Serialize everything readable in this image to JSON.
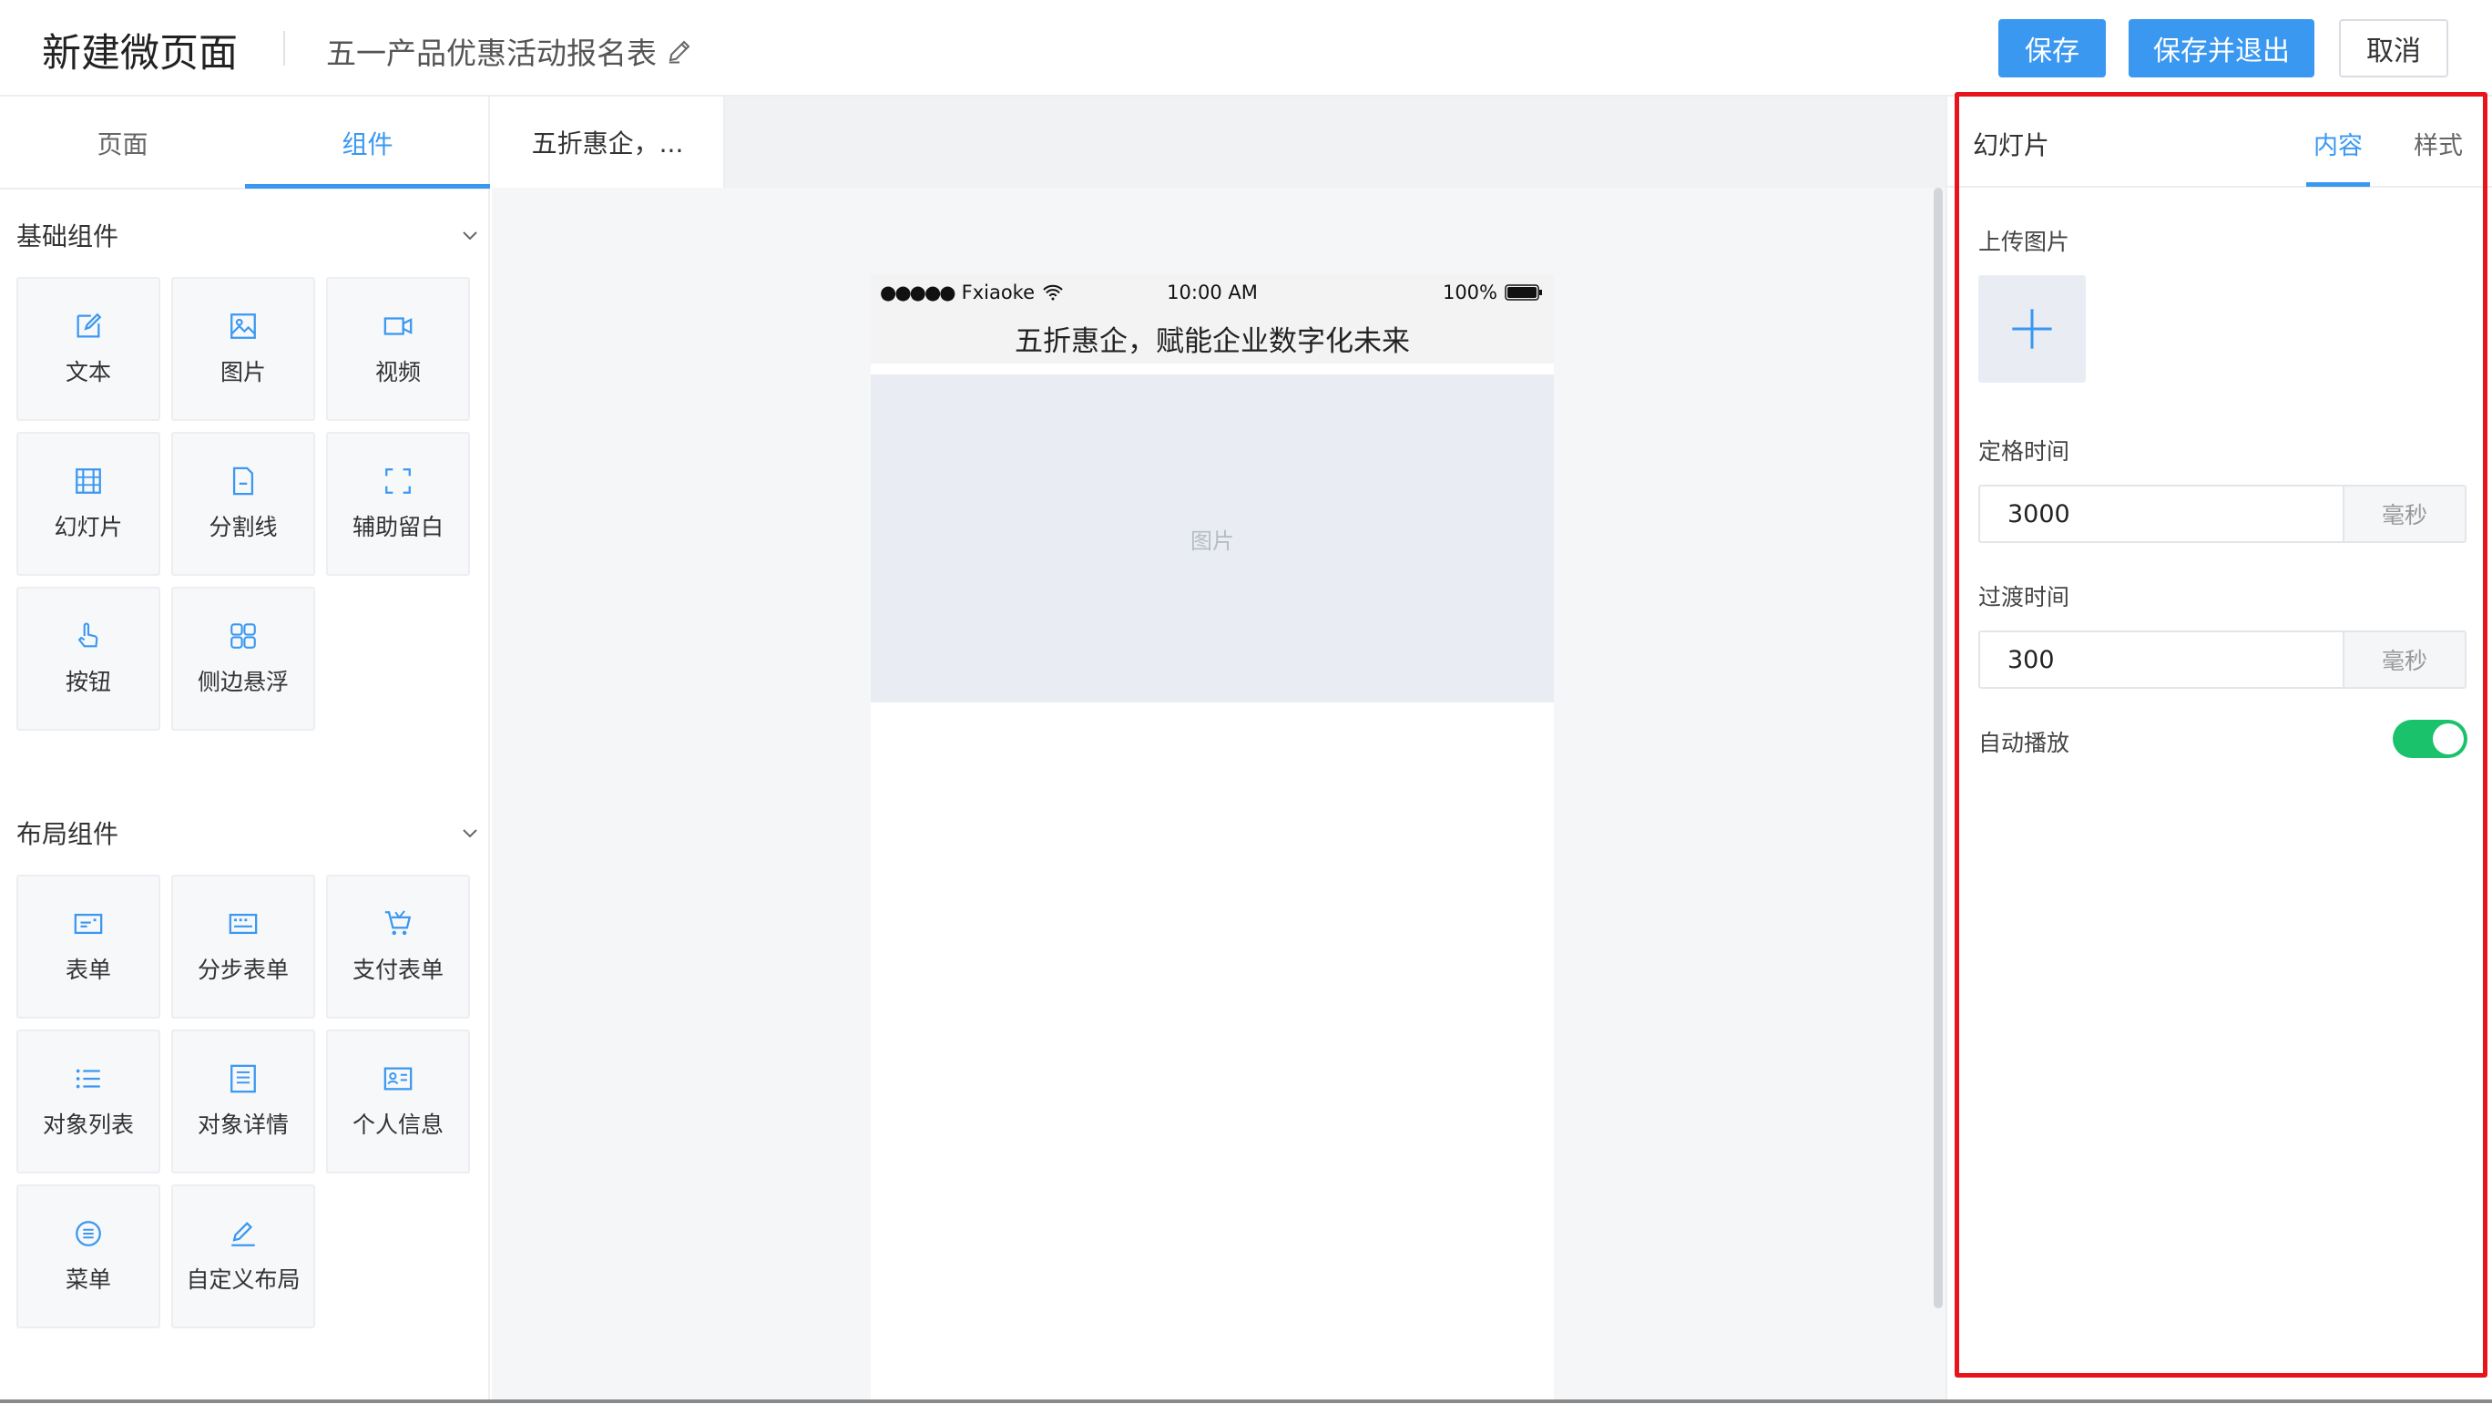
{
  "header": {
    "title": "新建微页面",
    "form_name": "五一产品优惠活动报名表",
    "save_label": "保存",
    "save_exit_label": "保存并退出",
    "cancel_label": "取消"
  },
  "left_tabs": {
    "page": "页面",
    "components": "组件"
  },
  "basic_section": {
    "title": "基础组件",
    "items": [
      {
        "label": "文本",
        "icon": "edit-icon"
      },
      {
        "label": "图片",
        "icon": "image-icon"
      },
      {
        "label": "视频",
        "icon": "video-icon"
      },
      {
        "label": "幻灯片",
        "icon": "slideshow-icon"
      },
      {
        "label": "分割线",
        "icon": "divider-icon"
      },
      {
        "label": "辅助留白",
        "icon": "whitespace-icon"
      },
      {
        "label": "按钮",
        "icon": "tap-icon"
      },
      {
        "label": "侧边悬浮",
        "icon": "grid-icon"
      }
    ]
  },
  "layout_section": {
    "title": "布局组件",
    "items": [
      {
        "label": "表单",
        "icon": "form-icon"
      },
      {
        "label": "分步表单",
        "icon": "step-form-icon"
      },
      {
        "label": "支付表单",
        "icon": "cart-icon"
      },
      {
        "label": "对象列表",
        "icon": "list-icon"
      },
      {
        "label": "对象详情",
        "icon": "detail-icon"
      },
      {
        "label": "个人信息",
        "icon": "id-card-icon"
      },
      {
        "label": "菜单",
        "icon": "menu-icon"
      },
      {
        "label": "自定义布局",
        "icon": "pen-icon"
      }
    ]
  },
  "canvas": {
    "page_tab": "五折惠企，...",
    "status_carrier": "Fxiaoke",
    "status_time": "10:00 AM",
    "status_battery": "100%",
    "phone_title": "五折惠企，赋能企业数字化未来",
    "slide_placeholder": "图片"
  },
  "props": {
    "title": "幻灯片",
    "tab_content": "内容",
    "tab_style": "样式",
    "upload_label": "上传图片",
    "hold_label": "定格时间",
    "hold_value": "3000",
    "hold_unit": "毫秒",
    "transition_label": "过渡时间",
    "transition_value": "300",
    "transition_unit": "毫秒",
    "autoplay_label": "自动播放",
    "autoplay_on": true
  },
  "colors": {
    "accent": "#3a98f1",
    "toggle_on": "#19c26b",
    "highlight": "#e8141b"
  }
}
